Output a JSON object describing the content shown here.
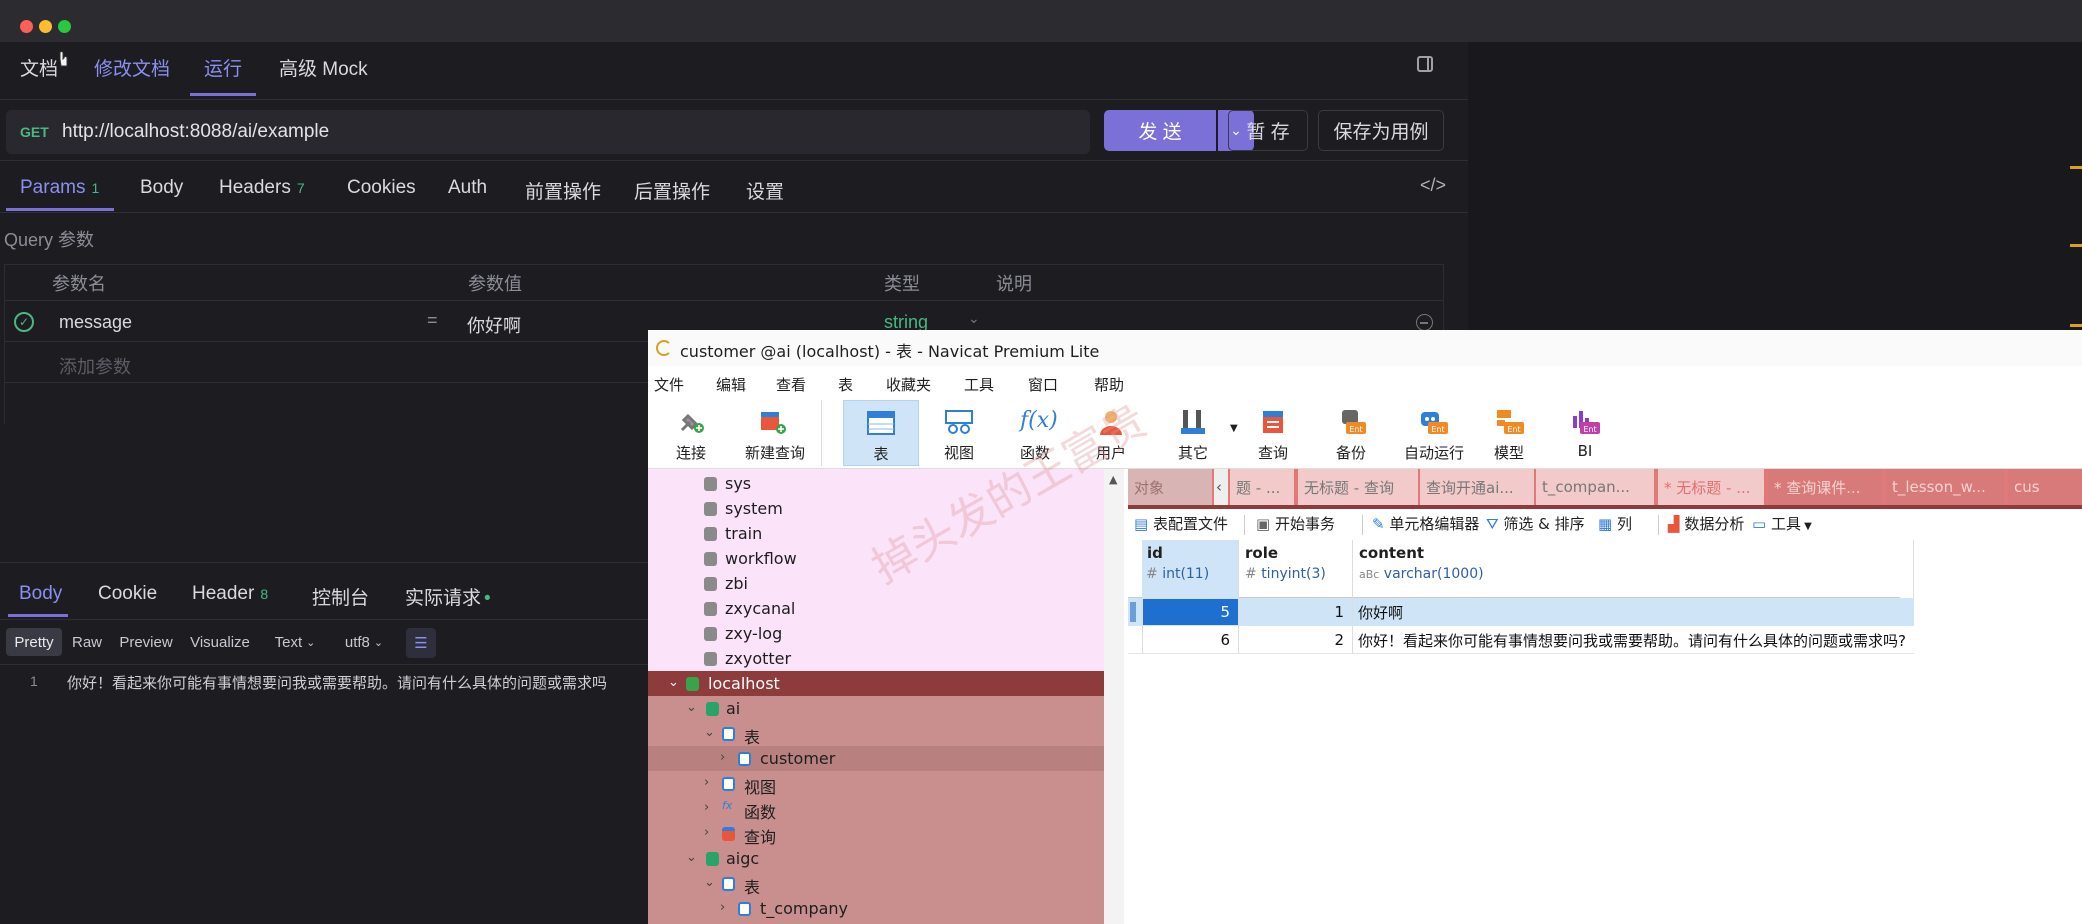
{
  "api_tool": {
    "top_tabs": [
      "文档",
      "修改文档",
      "运行",
      "高级 Mock"
    ],
    "method": "GET",
    "url": "http://localhost:8088/ai/example",
    "send_label": "发 送",
    "save_draft_label": "暂 存",
    "save_case_label": "保存为用例",
    "req_tabs": [
      {
        "label": "Params",
        "badge": "1"
      },
      {
        "label": "Body",
        "badge": ""
      },
      {
        "label": "Headers",
        "badge": "7"
      },
      {
        "label": "Cookies",
        "badge": ""
      },
      {
        "label": "Auth",
        "badge": ""
      },
      {
        "label": "前置操作",
        "badge": ""
      },
      {
        "label": "后置操作",
        "badge": ""
      },
      {
        "label": "设置",
        "badge": ""
      }
    ],
    "query_title": "Query 参数",
    "columns": [
      "参数名",
      "参数值",
      "类型",
      "说明"
    ],
    "param": {
      "name": "message",
      "eq": "=",
      "value": "你好啊",
      "type": "string"
    },
    "add_param_placeholder": "添加参数",
    "resp_tabs": [
      {
        "label": "Body",
        "badge": ""
      },
      {
        "label": "Cookie",
        "badge": ""
      },
      {
        "label": "Header",
        "badge": "8"
      },
      {
        "label": "控制台",
        "badge": ""
      },
      {
        "label": "实际请求",
        "badge": "•"
      }
    ],
    "view_modes": [
      "Pretty",
      "Raw",
      "Preview",
      "Visualize"
    ],
    "format": "Text",
    "encoding": "utf8",
    "response_line_no": "1",
    "response_text": "你好！看起来你可能有事情想要问我或需要帮助。请问有什么具体的问题或需求吗"
  },
  "navicat": {
    "title": "customer @ai (localhost) - 表 - Navicat Premium Lite",
    "menu": [
      "文件",
      "编辑",
      "查看",
      "表",
      "收藏夹",
      "工具",
      "窗口",
      "帮助"
    ],
    "toolbar": [
      {
        "label": "连接",
        "icon": "connect-icon"
      },
      {
        "label": "新建查询",
        "icon": "new-query-icon"
      },
      {
        "label": "表",
        "icon": "table-icon"
      },
      {
        "label": "视图",
        "icon": "view-icon"
      },
      {
        "label": "函数",
        "icon": "function-icon"
      },
      {
        "label": "用户",
        "icon": "user-icon"
      },
      {
        "label": "其它",
        "icon": "tools-icon"
      },
      {
        "label": "查询",
        "icon": "query-icon"
      },
      {
        "label": "备份",
        "icon": "backup-icon"
      },
      {
        "label": "自动运行",
        "icon": "robot-icon"
      },
      {
        "label": "模型",
        "icon": "model-icon"
      },
      {
        "label": "BI",
        "icon": "bi-icon"
      }
    ],
    "tree": [
      {
        "label": "sys",
        "type": "db-gray"
      },
      {
        "label": "system",
        "type": "db-gray"
      },
      {
        "label": "train",
        "type": "db-gray"
      },
      {
        "label": "workflow",
        "type": "db-gray"
      },
      {
        "label": "zbi",
        "type": "db-gray"
      },
      {
        "label": "zxycanal",
        "type": "db-gray"
      },
      {
        "label": "zxy-log",
        "type": "db-gray"
      },
      {
        "label": "zxyotter",
        "type": "db-gray"
      },
      {
        "label": "localhost",
        "type": "conn"
      },
      {
        "label": "ai",
        "type": "db-green"
      },
      {
        "label": "表",
        "type": "table-folder"
      },
      {
        "label": "customer",
        "type": "table"
      },
      {
        "label": "视图",
        "type": "view-folder"
      },
      {
        "label": "函数",
        "type": "func-folder"
      },
      {
        "label": "查询",
        "type": "query-folder"
      },
      {
        "label": "aigc",
        "type": "db-green"
      },
      {
        "label": "表",
        "type": "table-folder"
      },
      {
        "label": "t_company",
        "type": "table"
      }
    ],
    "doc_tabs": [
      "对象",
      "题 - ...",
      "无标题 - 查询",
      "查询开通ai...",
      "t_compan...",
      "* 无标题 - ...",
      "* 查询课件...",
      "t_lesson_w...",
      "cus"
    ],
    "subtoolbar": [
      "表配置文件",
      "开始事务",
      "单元格编辑器",
      "筛选 & 排序",
      "列",
      "数据分析",
      "工具"
    ],
    "columns": [
      {
        "name": "id",
        "type": "int(11)"
      },
      {
        "name": "role",
        "type": "tinyint(3)"
      },
      {
        "name": "content",
        "type": "varchar(1000)"
      }
    ],
    "rows": [
      {
        "id": "5",
        "role": "1",
        "content": "你好啊"
      },
      {
        "id": "6",
        "role": "2",
        "content": "你好！看起来你可能有事情想要问我或需要帮助。请问有什么具体的问题或需求吗?"
      }
    ],
    "watermark": "掉头发的王富贵"
  },
  "colors": {
    "accent": "#7b6fd8",
    "link_tab": "#8a8ff0",
    "badge": "#49b883",
    "tree_pink": "#fbe3fa",
    "tree_red": "#c98f8f"
  }
}
